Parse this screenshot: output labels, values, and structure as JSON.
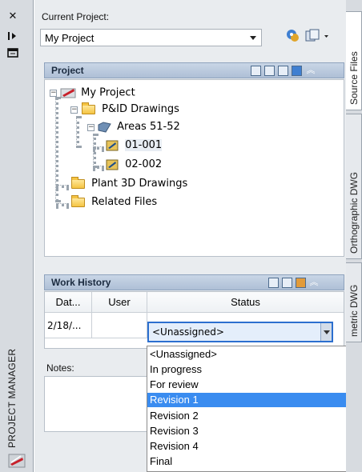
{
  "palette": {
    "accent": "#3a8cf0",
    "header": "#aebfd6",
    "folder": "#f5c443"
  },
  "side_panel": {
    "title": "PROJECT MANAGER",
    "tools": [
      "close-icon",
      "pin-icon",
      "properties-icon"
    ]
  },
  "current_project": {
    "label": "Current Project:",
    "value": "My Project"
  },
  "project_section": {
    "title": "Project",
    "tree": {
      "root": "My Project",
      "pid_folder": "P&ID Drawings",
      "area": "Areas 51-52",
      "drawing1": "01-001",
      "drawing2": "02-002",
      "plant3d_folder": "Plant 3D Drawings",
      "related_folder": "Related Files"
    }
  },
  "work_history": {
    "title": "Work History",
    "columns": [
      "Dat...",
      "User",
      "Status"
    ],
    "row": {
      "date": "2/18/...",
      "user": "",
      "status": "<Unassigned>"
    }
  },
  "notes": {
    "label": "Notes:"
  },
  "status_dropdown": {
    "options": [
      "<Unassigned>",
      "In progress",
      "For review",
      "Revision 1",
      "Revision 2",
      "Revision 3",
      "Revision 4",
      "Final"
    ],
    "highlighted": "Revision 1"
  },
  "right_tabs": [
    "Source Files",
    "Orthographic DWG",
    "metric DWG"
  ]
}
